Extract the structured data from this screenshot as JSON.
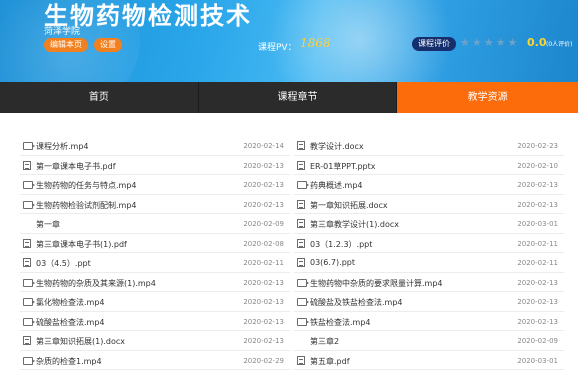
{
  "header": {
    "title": "生物药物检测技术",
    "school": "菏泽学院",
    "edit_label": "编辑本页",
    "settings_label": "设置",
    "pv_label": "课程PV：",
    "pv_value": "1868",
    "eval_label": "课程评价",
    "rating": "0.0",
    "rating_sub": "(0人评价)"
  },
  "nav": {
    "items": [
      "首页",
      "课程章节",
      "教学资源"
    ],
    "active": 2
  },
  "resources": {
    "left": [
      {
        "icon": "video",
        "name": "课程分析.mp4",
        "date": "2020-02-14"
      },
      {
        "icon": "doc",
        "name": "第一章课本电子书.pdf",
        "date": "2020-02-13"
      },
      {
        "icon": "video",
        "name": "生物药物的任务与特点.mp4",
        "date": "2020-02-13"
      },
      {
        "icon": "video",
        "name": "生物药物检验试剂配制.mp4",
        "date": "2020-02-13"
      },
      {
        "icon": "none",
        "name": "第一章",
        "date": "2020-02-09"
      },
      {
        "icon": "doc",
        "name": "第三章课本电子书(1).pdf",
        "date": "2020-02-08"
      },
      {
        "icon": "doc",
        "name": "03（4.5）.ppt",
        "date": "2020-02-11"
      },
      {
        "icon": "video",
        "name": "生物药物的杂质及其来源(1).mp4",
        "date": "2020-02-13"
      },
      {
        "icon": "video",
        "name": "氯化物检查法.mp4",
        "date": "2020-02-13"
      },
      {
        "icon": "video",
        "name": "硫酸盐检查法.mp4",
        "date": "2020-02-13"
      },
      {
        "icon": "doc",
        "name": "第三章知识拓展(1).docx",
        "date": "2020-02-13"
      },
      {
        "icon": "video",
        "name": "杂质的检查1.mp4",
        "date": "2020-02-29"
      }
    ],
    "right": [
      {
        "icon": "doc",
        "name": "教学设计.docx",
        "date": "2020-02-23"
      },
      {
        "icon": "doc",
        "name": "ER-01草PPT.pptx",
        "date": "2020-02-10"
      },
      {
        "icon": "video",
        "name": "药典概述.mp4",
        "date": "2020-02-13"
      },
      {
        "icon": "doc",
        "name": "第一章知识拓展.docx",
        "date": "2020-02-13"
      },
      {
        "icon": "doc",
        "name": "第三章教学设计(1).docx",
        "date": "2020-03-01"
      },
      {
        "icon": "doc",
        "name": "03（1.2.3）.ppt",
        "date": "2020-02-11"
      },
      {
        "icon": "doc",
        "name": "03(6.7).ppt",
        "date": "2020-02-11"
      },
      {
        "icon": "video",
        "name": "生物药物中杂质的要求限量计算.mp4",
        "date": "2020-02-13"
      },
      {
        "icon": "video",
        "name": "硫酸盐及铁盐检查法.mp4",
        "date": "2020-02-13"
      },
      {
        "icon": "video",
        "name": "铁盐检查法.mp4",
        "date": "2020-02-13"
      },
      {
        "icon": "none",
        "name": "第三章2",
        "date": "2020-02-09"
      },
      {
        "icon": "doc",
        "name": "第五章.pdf",
        "date": "2020-03-01"
      }
    ]
  }
}
